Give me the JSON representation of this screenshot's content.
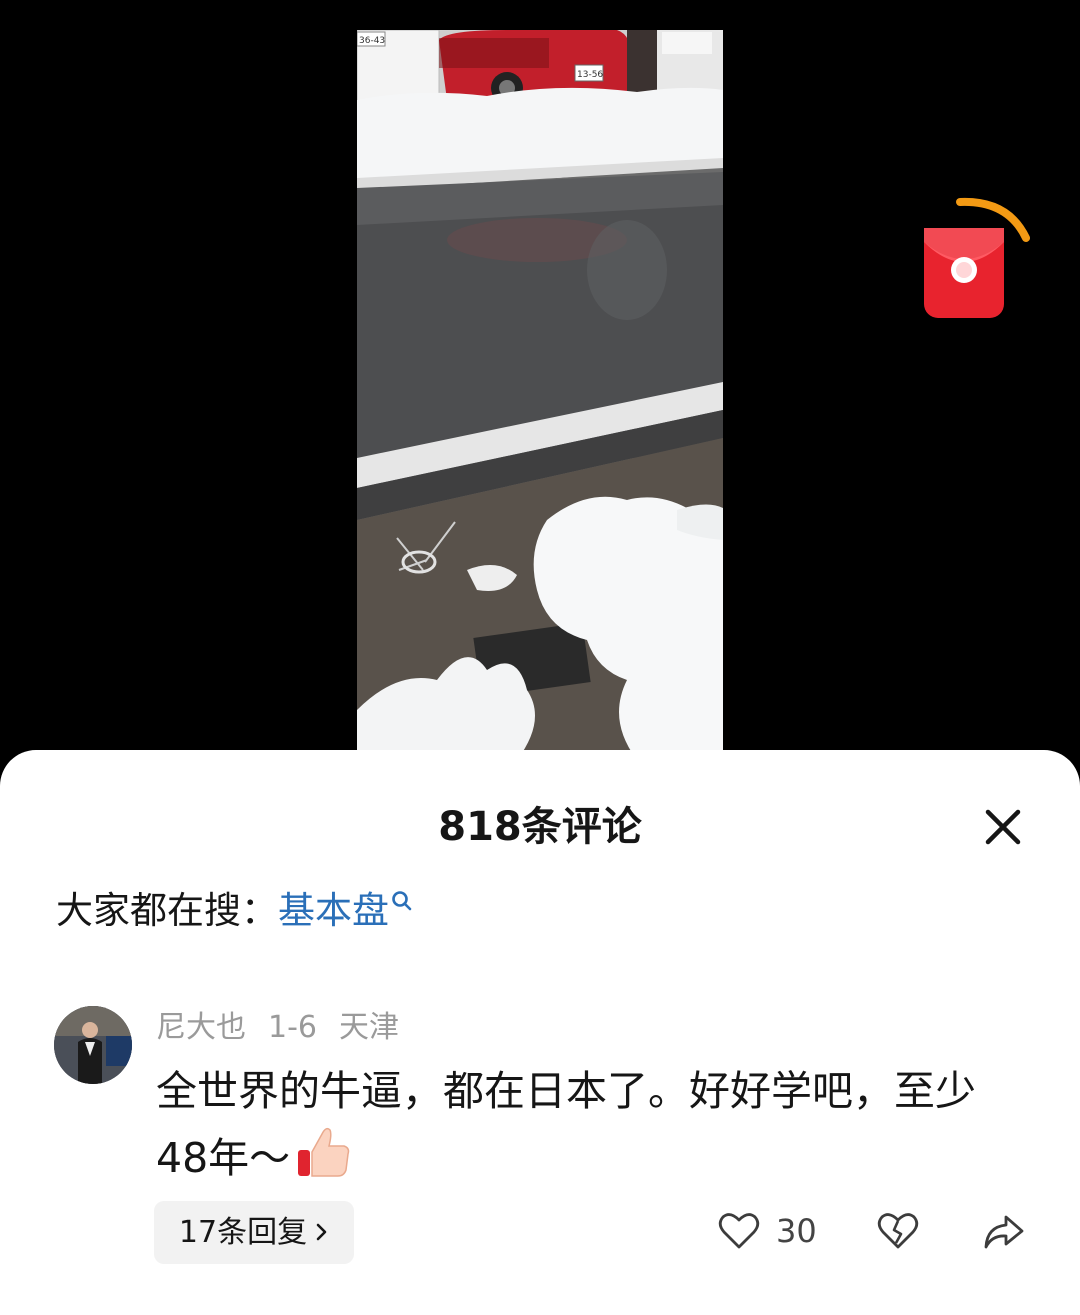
{
  "video": {
    "plate_left": "36-43",
    "plate_right": "13-56"
  },
  "comments_panel": {
    "title": "818条评论",
    "hot_search_prefix": "大家都在搜：",
    "hot_search_term": "基本盘",
    "comment": {
      "author": "尼大也",
      "date": "1-6",
      "location": "天津",
      "text": "全世界的牛逼，都在日本了。好好学吧，至少48年～",
      "emoji": "thumbs-up",
      "replies_label": "17条回复",
      "like_count": "30"
    }
  },
  "colors": {
    "link": "#2a6fb8",
    "redpacket": "#e8232e",
    "progress_ring": "#f39a14"
  }
}
